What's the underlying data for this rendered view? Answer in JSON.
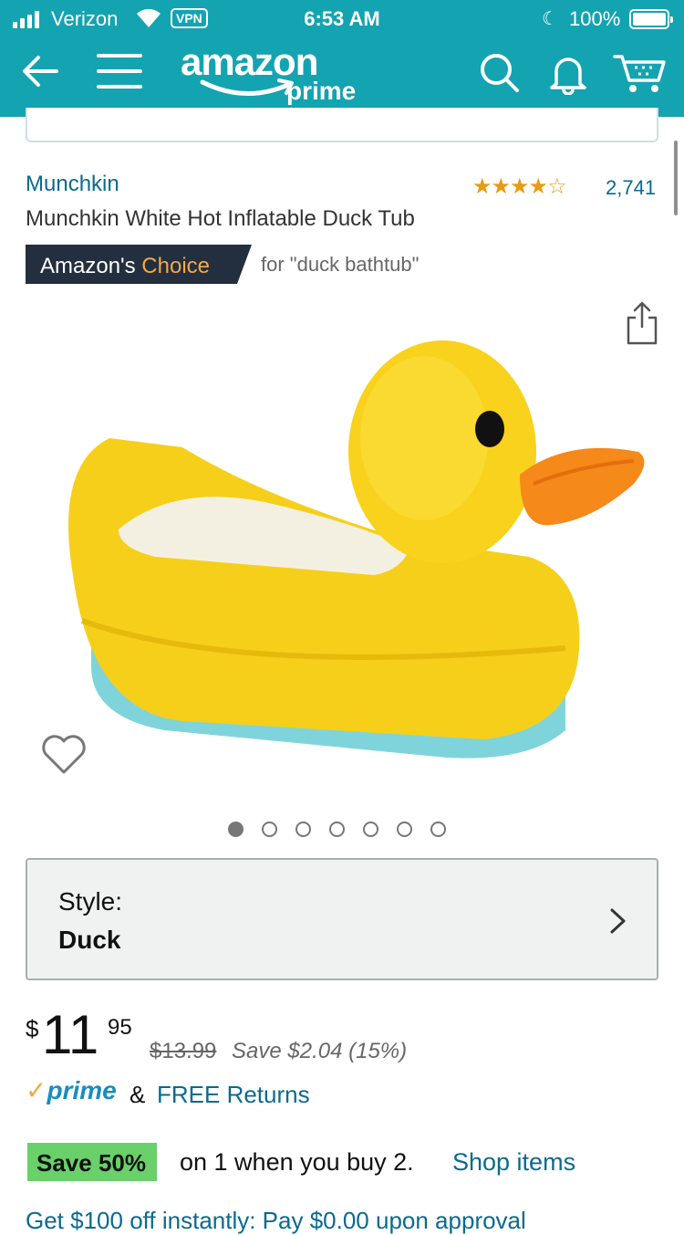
{
  "status_bar": {
    "carrier": "Verizon",
    "vpn": "VPN",
    "time": "6:53 AM",
    "battery": "100%"
  },
  "header": {
    "logo_word": "amazon",
    "logo_sub": "prime",
    "icons": [
      "back-arrow-icon",
      "menu-icon",
      "search-icon",
      "bell-icon",
      "cart-icon"
    ],
    "bg_color": "#14a3b1"
  },
  "product": {
    "brand": "Munchkin",
    "stars": "★★★★☆",
    "rating": 4.5,
    "reviews": "2,741",
    "title": "Munchkin White Hot Inflatable Duck Tub",
    "badge": {
      "prefix": "Amazon's",
      "highlight": "Choice",
      "for": "for \"duck bathtub\""
    },
    "image_count": 7,
    "active_image": 0
  },
  "style": {
    "label": "Style:",
    "value": "Duck"
  },
  "price": {
    "currency": "$",
    "whole": "11",
    "cents": "95",
    "list_price": "$13.99",
    "savings": "Save $2.04 (15%)"
  },
  "shipping": {
    "prime_check": "✓",
    "prime": "prime",
    "amp": "&",
    "free_returns": "FREE Returns"
  },
  "promo": {
    "badge": "Save 50%",
    "text": "on 1 when you buy 2.",
    "link": "Shop items",
    "cutoff": "Get $100 off instantly: Pay $0.00 upon approval"
  }
}
